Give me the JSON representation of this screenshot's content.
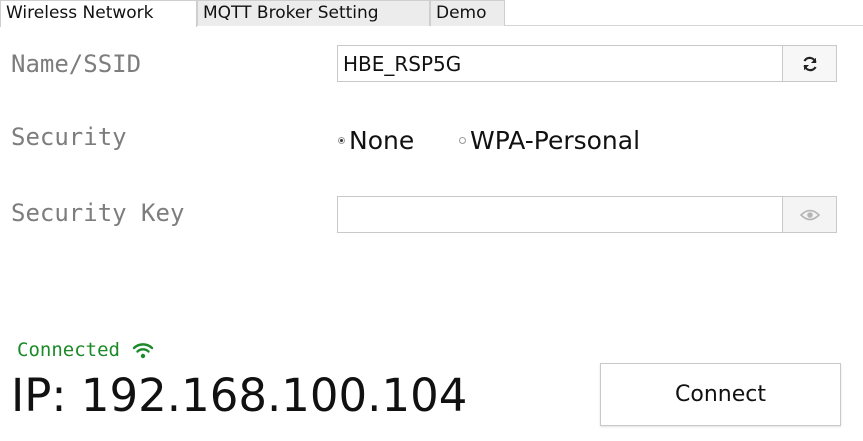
{
  "tabs": [
    {
      "label": "Wireless Network",
      "active": true
    },
    {
      "label": "MQTT Broker Setting",
      "active": false
    },
    {
      "label": "Demo",
      "active": false
    }
  ],
  "form": {
    "ssid_label": "Name/SSID",
    "ssid_value": "HBE_RSP5G",
    "refresh_icon": "refresh-icon",
    "security_label": "Security",
    "security_options": [
      {
        "label": "None",
        "checked": true
      },
      {
        "label": "WPA-Personal",
        "checked": false
      }
    ],
    "key_label": "Security Key",
    "key_value": "",
    "eye_icon": "eye-icon"
  },
  "status": {
    "text": "Connected",
    "icon": "wifi-icon",
    "color": "#1d8a2a",
    "ip": "IP: 192.168.100.104"
  },
  "connect_button": {
    "label": "Connect"
  }
}
